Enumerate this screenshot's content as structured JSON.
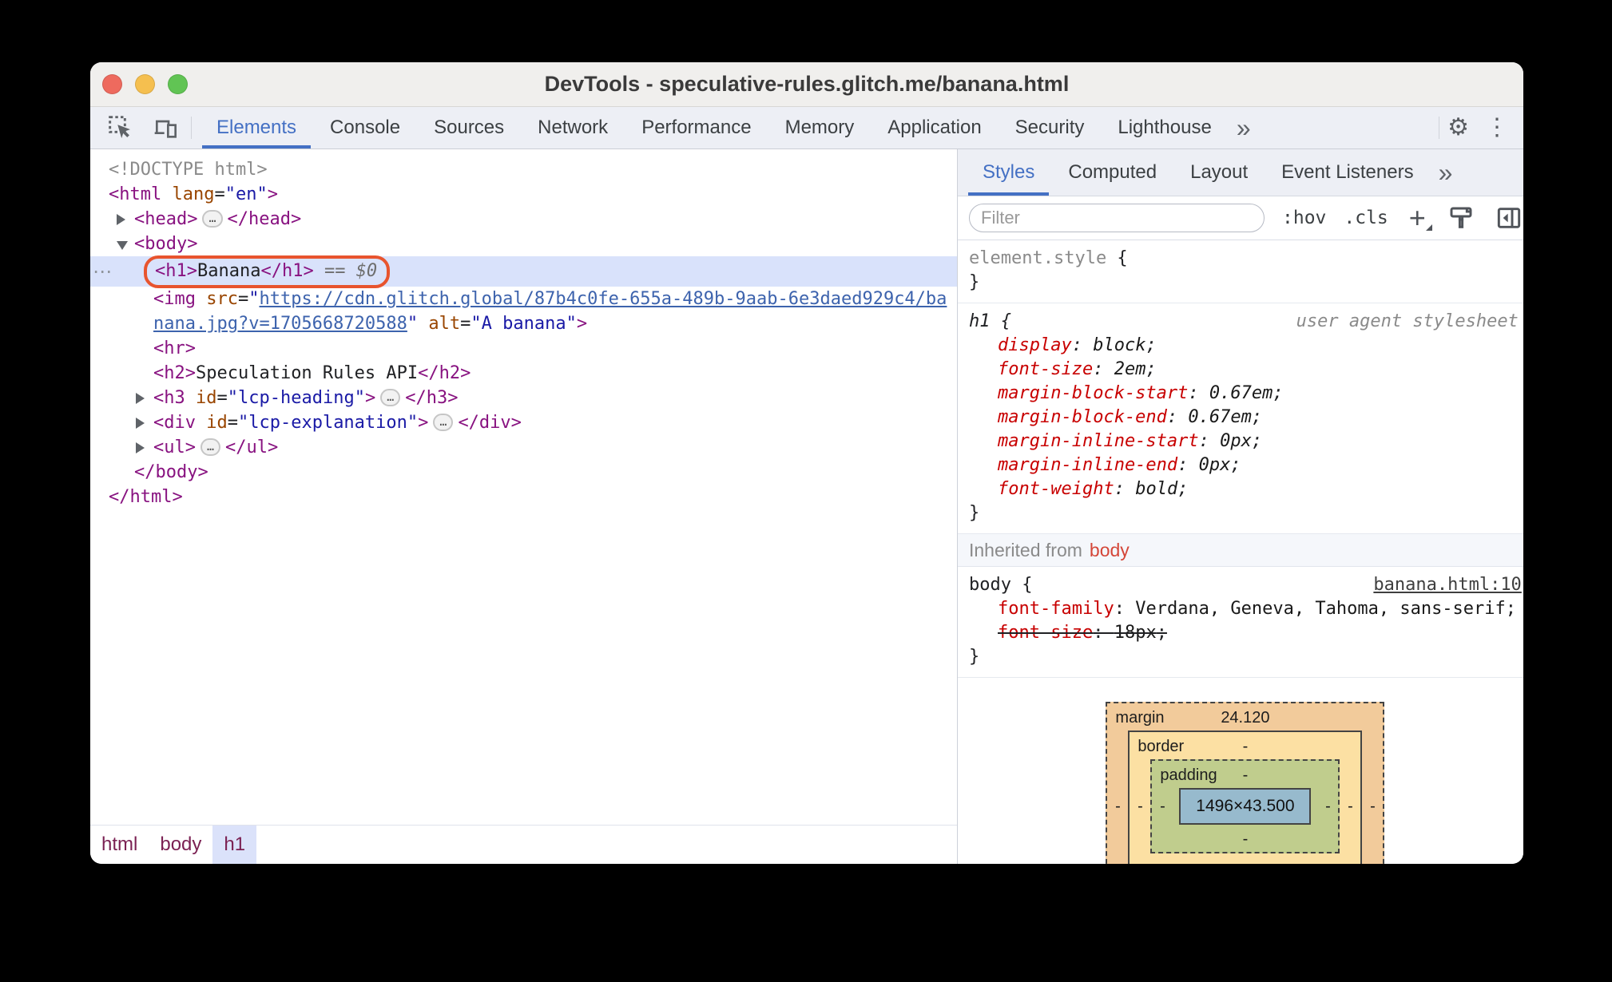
{
  "window": {
    "title": "DevTools - speculative-rules.glitch.me/banana.html"
  },
  "toolbar": {
    "tabs": [
      {
        "label": "Elements",
        "active": true
      },
      {
        "label": "Console",
        "active": false
      },
      {
        "label": "Sources",
        "active": false
      },
      {
        "label": "Network",
        "active": false
      },
      {
        "label": "Performance",
        "active": false
      },
      {
        "label": "Memory",
        "active": false
      },
      {
        "label": "Application",
        "active": false
      },
      {
        "label": "Security",
        "active": false
      },
      {
        "label": "Lighthouse",
        "active": false
      }
    ],
    "overflow_icon": "»",
    "gear_icon": "⚙",
    "menu_icon": "⋮"
  },
  "icons": {
    "ellipsis": "…",
    "row_menu": "⋯"
  },
  "tree": {
    "rows": [
      {
        "name": "doctype",
        "indent": 0,
        "segs": [
          {
            "s": "gray",
            "t": "<!DOCTYPE html>"
          }
        ]
      },
      {
        "name": "html-open",
        "indent": 0,
        "segs": [
          {
            "s": "tag",
            "t": "<html"
          },
          {
            "s": "plain",
            "t": " "
          },
          {
            "s": "attr",
            "t": "lang"
          },
          {
            "s": "plain",
            "t": "="
          },
          {
            "s": "val",
            "t": "\"en\""
          },
          {
            "s": "tag",
            "t": ">"
          }
        ]
      },
      {
        "name": "head-node",
        "indent": 1,
        "arrow": "right",
        "segs": [
          {
            "s": "tag",
            "t": "<head>"
          },
          {
            "s": "pill"
          },
          {
            "s": "tag",
            "t": "</head>"
          }
        ]
      },
      {
        "name": "body-open",
        "indent": 1,
        "arrow": "down",
        "segs": [
          {
            "s": "tag",
            "t": "<body>"
          }
        ]
      },
      {
        "name": "h1-node-selected",
        "indent": 2,
        "selected": true,
        "ring": true,
        "gutter": true,
        "segs": [
          {
            "s": "tag",
            "t": "<h1>"
          },
          {
            "s": "plain",
            "t": "Banana"
          },
          {
            "s": "tag",
            "t": "</h1>"
          },
          {
            "s": "eq",
            "t": " == "
          },
          {
            "s": "eq",
            "t": "$0"
          }
        ]
      },
      {
        "name": "img-node-line1",
        "indent": 2,
        "segs": [
          {
            "s": "tag",
            "t": "<img"
          },
          {
            "s": "plain",
            "t": " "
          },
          {
            "s": "attr",
            "t": "src"
          },
          {
            "s": "plain",
            "t": "="
          },
          {
            "s": "val",
            "t": "\""
          },
          {
            "s": "link",
            "t": "https://cdn.glitch.global/87b4c0fe-655a-489b-9aab-6e3daed929c4/ba"
          }
        ]
      },
      {
        "name": "img-node-line2",
        "indent": 2,
        "segs": [
          {
            "s": "link",
            "t": "nana.jpg?v=1705668720588"
          },
          {
            "s": "val",
            "t": "\""
          },
          {
            "s": "plain",
            "t": " "
          },
          {
            "s": "attr",
            "t": "alt"
          },
          {
            "s": "plain",
            "t": "="
          },
          {
            "s": "val",
            "t": "\"A banana\""
          },
          {
            "s": "tag",
            "t": ">"
          }
        ]
      },
      {
        "name": "hr-node",
        "indent": 2,
        "segs": [
          {
            "s": "tag",
            "t": "<hr>"
          }
        ]
      },
      {
        "name": "h2-node",
        "indent": 2,
        "segs": [
          {
            "s": "tag",
            "t": "<h2>"
          },
          {
            "s": "plain",
            "t": "Speculation Rules API"
          },
          {
            "s": "tag",
            "t": "</h2>"
          }
        ]
      },
      {
        "name": "h3-node",
        "indent": 2,
        "arrow": "right",
        "segs": [
          {
            "s": "tag",
            "t": "<h3"
          },
          {
            "s": "plain",
            "t": " "
          },
          {
            "s": "attr",
            "t": "id"
          },
          {
            "s": "plain",
            "t": "="
          },
          {
            "s": "val",
            "t": "\"lcp-heading\""
          },
          {
            "s": "tag",
            "t": ">"
          },
          {
            "s": "pill"
          },
          {
            "s": "tag",
            "t": "</h3>"
          }
        ]
      },
      {
        "name": "div-node",
        "indent": 2,
        "arrow": "right",
        "segs": [
          {
            "s": "tag",
            "t": "<div"
          },
          {
            "s": "plain",
            "t": " "
          },
          {
            "s": "attr",
            "t": "id"
          },
          {
            "s": "plain",
            "t": "="
          },
          {
            "s": "val",
            "t": "\"lcp-explanation\""
          },
          {
            "s": "tag",
            "t": ">"
          },
          {
            "s": "pill"
          },
          {
            "s": "tag",
            "t": "</div>"
          }
        ]
      },
      {
        "name": "ul-node",
        "indent": 2,
        "arrow": "right",
        "segs": [
          {
            "s": "tag",
            "t": "<ul>"
          },
          {
            "s": "pill"
          },
          {
            "s": "tag",
            "t": "</ul>"
          }
        ]
      },
      {
        "name": "body-close",
        "indent": 1,
        "segs": [
          {
            "s": "tag",
            "t": "</body>"
          }
        ]
      },
      {
        "name": "html-close",
        "indent": 0,
        "segs": [
          {
            "s": "tag",
            "t": "</html>"
          }
        ]
      }
    ]
  },
  "breadcrumb": {
    "items": [
      {
        "label": "html",
        "active": false
      },
      {
        "label": "body",
        "active": false
      },
      {
        "label": "h1",
        "active": true
      }
    ]
  },
  "sidebar": {
    "tabs": [
      {
        "label": "Styles",
        "active": true
      },
      {
        "label": "Computed",
        "active": false
      },
      {
        "label": "Layout",
        "active": false
      },
      {
        "label": "Event Listeners",
        "active": false
      }
    ],
    "overflow_icon": "»",
    "filter": {
      "placeholder": "Filter"
    },
    "toggles": {
      "hov": ":hov",
      "cls": ".cls"
    }
  },
  "styles": {
    "rules_top": [
      {
        "selector": "element.style",
        "selector_gray": true,
        "ua": false,
        "origin": "",
        "source": "",
        "props": []
      },
      {
        "selector": "h1",
        "selector_gray": false,
        "ua": true,
        "origin": "user agent stylesheet",
        "source": "",
        "props": [
          {
            "name": "display",
            "value": "block",
            "struck": false
          },
          {
            "name": "font-size",
            "value": "2em",
            "struck": false
          },
          {
            "name": "margin-block-start",
            "value": "0.67em",
            "struck": false
          },
          {
            "name": "margin-block-end",
            "value": "0.67em",
            "struck": false
          },
          {
            "name": "margin-inline-start",
            "value": "0px",
            "struck": false
          },
          {
            "name": "margin-inline-end",
            "value": "0px",
            "struck": false
          },
          {
            "name": "font-weight",
            "value": "bold",
            "struck": false
          }
        ]
      }
    ],
    "inherited": {
      "label": "Inherited from",
      "target": "body"
    },
    "rules_inherited": [
      {
        "selector": "body",
        "selector_gray": false,
        "ua": false,
        "origin": "",
        "source": "banana.html:10",
        "props": [
          {
            "name": "font-family",
            "value": "Verdana, Geneva, Tahoma, sans-serif",
            "struck": false
          },
          {
            "name": "font-size",
            "value": "18px",
            "struck": true
          }
        ]
      }
    ]
  },
  "box_model": {
    "margin_label": "margin",
    "margin_top": "24.120",
    "margin_left": "-",
    "margin_right": "-",
    "border_label": "border",
    "border_top": "-",
    "border_left": "-",
    "border_right": "-",
    "border_bottom": "-",
    "padding_label": "padding",
    "padding_top": "-",
    "padding_left": "-",
    "padding_right": "-",
    "padding_bottom": "-",
    "content": "1496×43.500"
  }
}
